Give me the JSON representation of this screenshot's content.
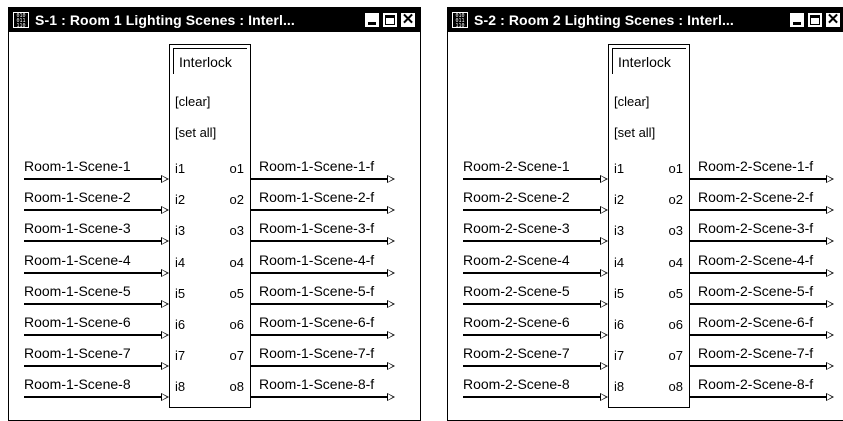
{
  "windows": [
    {
      "title": "S-1 : Room 1 Lighting Scenes : Interl...",
      "icon_name": "symbol-window-icon",
      "block": {
        "title": "Interlock",
        "clear_label": "[clear]",
        "set_all_label": "[set all]",
        "inputs": [
          "i1",
          "i2",
          "i3",
          "i4",
          "i5",
          "i6",
          "i7",
          "i8"
        ],
        "outputs": [
          "o1",
          "o2",
          "o3",
          "o4",
          "o5",
          "o6",
          "o7",
          "o8"
        ]
      },
      "input_signals": [
        "Room-1-Scene-1",
        "Room-1-Scene-2",
        "Room-1-Scene-3",
        "Room-1-Scene-4",
        "Room-1-Scene-5",
        "Room-1-Scene-6",
        "Room-1-Scene-7",
        "Room-1-Scene-8"
      ],
      "output_signals": [
        "Room-1-Scene-1-f",
        "Room-1-Scene-2-f",
        "Room-1-Scene-3-f",
        "Room-1-Scene-4-f",
        "Room-1-Scene-5-f",
        "Room-1-Scene-6-f",
        "Room-1-Scene-7-f",
        "Room-1-Scene-8-f"
      ]
    },
    {
      "title": "S-2 : Room 2 Lighting Scenes : Interl...",
      "icon_name": "symbol-window-icon",
      "block": {
        "title": "Interlock",
        "clear_label": "[clear]",
        "set_all_label": "[set all]",
        "inputs": [
          "i1",
          "i2",
          "i3",
          "i4",
          "i5",
          "i6",
          "i7",
          "i8"
        ],
        "outputs": [
          "o1",
          "o2",
          "o3",
          "o4",
          "o5",
          "o6",
          "o7",
          "o8"
        ]
      },
      "input_signals": [
        "Room-2-Scene-1",
        "Room-2-Scene-2",
        "Room-2-Scene-3",
        "Room-2-Scene-4",
        "Room-2-Scene-5",
        "Room-2-Scene-6",
        "Room-2-Scene-7",
        "Room-2-Scene-8"
      ],
      "output_signals": [
        "Room-2-Scene-1-f",
        "Room-2-Scene-2-f",
        "Room-2-Scene-3-f",
        "Room-2-Scene-4-f",
        "Room-2-Scene-5-f",
        "Room-2-Scene-6-f",
        "Room-2-Scene-7-f",
        "Room-2-Scene-8-f"
      ]
    }
  ],
  "title_buttons": {
    "close_glyph": "✕"
  }
}
